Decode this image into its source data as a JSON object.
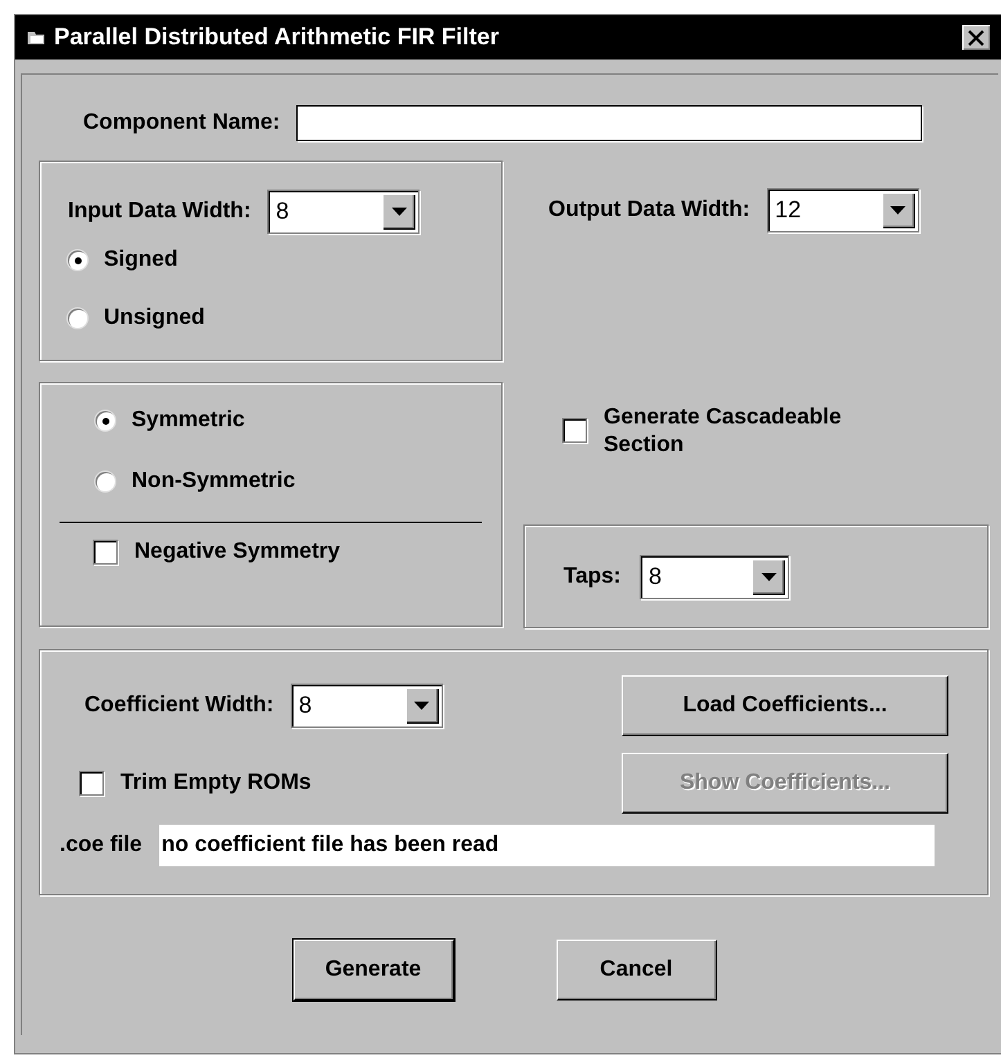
{
  "window": {
    "title": "Parallel Distributed Arithmetic FIR Filter"
  },
  "component_name": {
    "label": "Component Name:"
  },
  "input_data_width": {
    "label": "Input Data Width:",
    "value": "8"
  },
  "sign_options": [
    {
      "label": "Signed",
      "selected": true
    },
    {
      "label": "Unsigned",
      "selected": false
    }
  ],
  "output_data_width": {
    "label": "Output Data Width:",
    "value": "12"
  },
  "symmetry_options": [
    {
      "label": "Symmetric",
      "selected": true
    },
    {
      "label": "Non-Symmetric",
      "selected": false
    }
  ],
  "negative_symmetry": {
    "label": "Negative Symmetry",
    "checked": false
  },
  "cascadeable": {
    "label": "Generate Cascadeable Section",
    "checked": false
  },
  "taps": {
    "label": "Taps:",
    "value": "8"
  },
  "coefficient_width": {
    "label": "Coefficient Width:",
    "value": "8"
  },
  "load_button": {
    "label": "Load Coefficients...",
    "disabled": false
  },
  "trim_empty_roms": {
    "label": "Trim Empty ROMs",
    "checked": false
  },
  "show_button": {
    "label": "Show Coefficients...",
    "disabled": true
  },
  "coe_file": {
    "label": ".coe file",
    "value": "no coefficient file has been read"
  },
  "buttons": [
    {
      "label": "Generate",
      "default": true
    },
    {
      "label": "Cancel",
      "default": false
    }
  ]
}
